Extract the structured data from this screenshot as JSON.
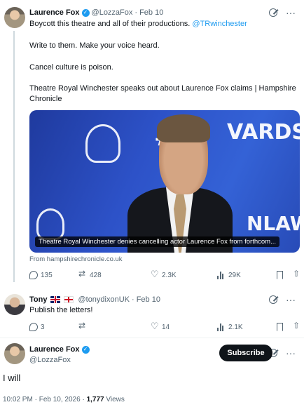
{
  "tweet1": {
    "name": "Laurence Fox",
    "handle": "@LozzaFox",
    "sep": "·",
    "date": "Feb 10",
    "line1": "Boycott this theatre and all of their productions. ",
    "mention": "@TRwinchester",
    "line2": "Write to them. Make your voice heard.",
    "line3": "Cancel culture is poison.",
    "line4": "Theatre Royal Winchester speaks out about Laurence Fox claims | Hampshire Chronicle",
    "card": {
      "bg_text_1": "#",
      "bg_text_2": "VARDS",
      "bg_text_3": "NLAW",
      "caption": "Theatre Royal Winchester denies cancelling actor Laurence Fox from forthcom...",
      "from": "From hampshirechronicle.co.uk"
    },
    "stats": {
      "replies": "135",
      "reposts": "428",
      "likes": "2.3K",
      "views": "29K"
    }
  },
  "tweet2": {
    "name": "Tony",
    "handle": "@tonydixonUK",
    "sep": "·",
    "date": "Feb 10",
    "text": "Publish the letters!",
    "stats": {
      "replies": "3",
      "reposts": "",
      "likes": "14",
      "views": "2.1K"
    }
  },
  "focus": {
    "name": "Laurence Fox",
    "handle": "@LozzaFox",
    "subscribe_label": "Subscribe",
    "text": "I will",
    "time": "10:02 PM",
    "sep": "·",
    "date": "Feb 10, 2026",
    "views_count": "1,777",
    "views_label": "Views"
  },
  "icons": {
    "verified": "✓",
    "more": "···"
  },
  "colors": {
    "accent": "#1d9bf0",
    "text": "#0f1419",
    "muted": "#536471"
  }
}
